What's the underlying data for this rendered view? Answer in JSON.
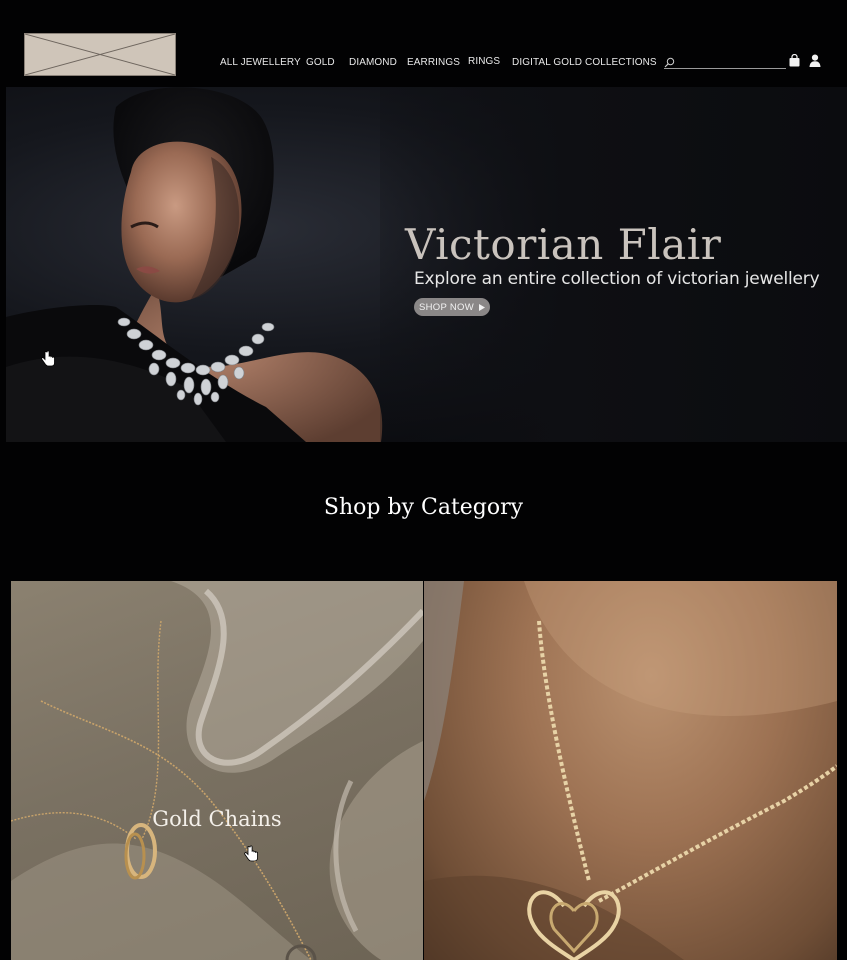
{
  "header": {
    "nav": [
      {
        "label": "ALL JEWELLERY"
      },
      {
        "label": "GOLD"
      },
      {
        "label": "DIAMOND"
      },
      {
        "label": "EARRINGS"
      },
      {
        "label": "RINGS"
      },
      {
        "label": "DIGITAL GOLD"
      },
      {
        "label": "COLLECTIONS"
      }
    ],
    "search_placeholder": "",
    "icons": [
      "search-icon",
      "shopping-bag-icon",
      "user-icon"
    ]
  },
  "hero": {
    "title": "Victorian Flair",
    "subtitle": "Explore an entire collection of victorian jewellery",
    "cta_label": "SHOP NOW",
    "cta_icon": "play-arrow-icon"
  },
  "categories": {
    "heading": "Shop by Category",
    "tiles": [
      {
        "label": "Gold Chains"
      },
      {
        "label": ""
      }
    ]
  },
  "colors": {
    "background": "#020203",
    "logo_placeholder": "#cfc5b9",
    "cta_button": "#8a8787",
    "hero_title": "#c9c3bd"
  }
}
